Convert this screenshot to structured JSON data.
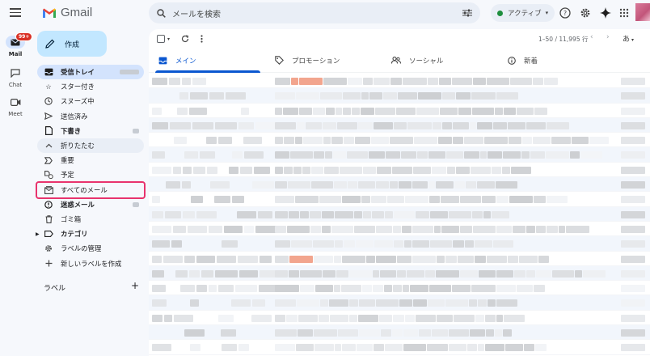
{
  "app": {
    "logo_text": "Gmail",
    "brand_colors": [
      "#ea4335",
      "#fbbc04",
      "#34a853",
      "#4285f4"
    ]
  },
  "rail": {
    "items": [
      {
        "label": "Mail",
        "icon": "mail-icon",
        "badge": "99+"
      },
      {
        "label": "Chat",
        "icon": "chat-icon"
      },
      {
        "label": "Meet",
        "icon": "video-icon"
      }
    ]
  },
  "search": {
    "placeholder": "メールを検索"
  },
  "status": {
    "label": "アクティブ",
    "color": "#1e8e3e"
  },
  "compose": {
    "label": "作成"
  },
  "nav": {
    "items": [
      {
        "label": "受信トレイ",
        "icon": "inbox-icon",
        "active": true
      },
      {
        "label": "スター付き",
        "icon": "star-icon"
      },
      {
        "label": "スヌーズ中",
        "icon": "clock-icon"
      },
      {
        "label": "送信済み",
        "icon": "send-icon"
      },
      {
        "label": "下書き",
        "icon": "draft-icon",
        "bold": true
      },
      {
        "label": "折りたたむ",
        "icon": "chevron-up-icon"
      },
      {
        "label": "重要",
        "icon": "important-icon"
      },
      {
        "label": "予定",
        "icon": "scheduled-icon"
      },
      {
        "label": "すべてのメール",
        "icon": "all-mail-icon",
        "highlighted": true
      },
      {
        "label": "迷惑メール",
        "icon": "spam-icon",
        "bold": true
      },
      {
        "label": "ゴミ箱",
        "icon": "trash-icon"
      },
      {
        "label": "カテゴリ",
        "icon": "label-icon",
        "bold": true
      },
      {
        "label": "ラベルの管理",
        "icon": "gear-icon"
      },
      {
        "label": "新しいラベルを作成",
        "icon": "plus-icon"
      }
    ],
    "labels_heading": "ラベル"
  },
  "toolbar": {
    "pager": "1–50 / 11,995 行",
    "lang_label": "あ"
  },
  "tabs": [
    {
      "label": "メイン",
      "icon": "inbox-tab-icon",
      "active": true
    },
    {
      "label": "プロモーション",
      "icon": "tag-icon"
    },
    {
      "label": "ソーシャル",
      "icon": "people-icon"
    },
    {
      "label": "新着",
      "icon": "info-icon"
    }
  ],
  "highlight_color": "#e8336d"
}
